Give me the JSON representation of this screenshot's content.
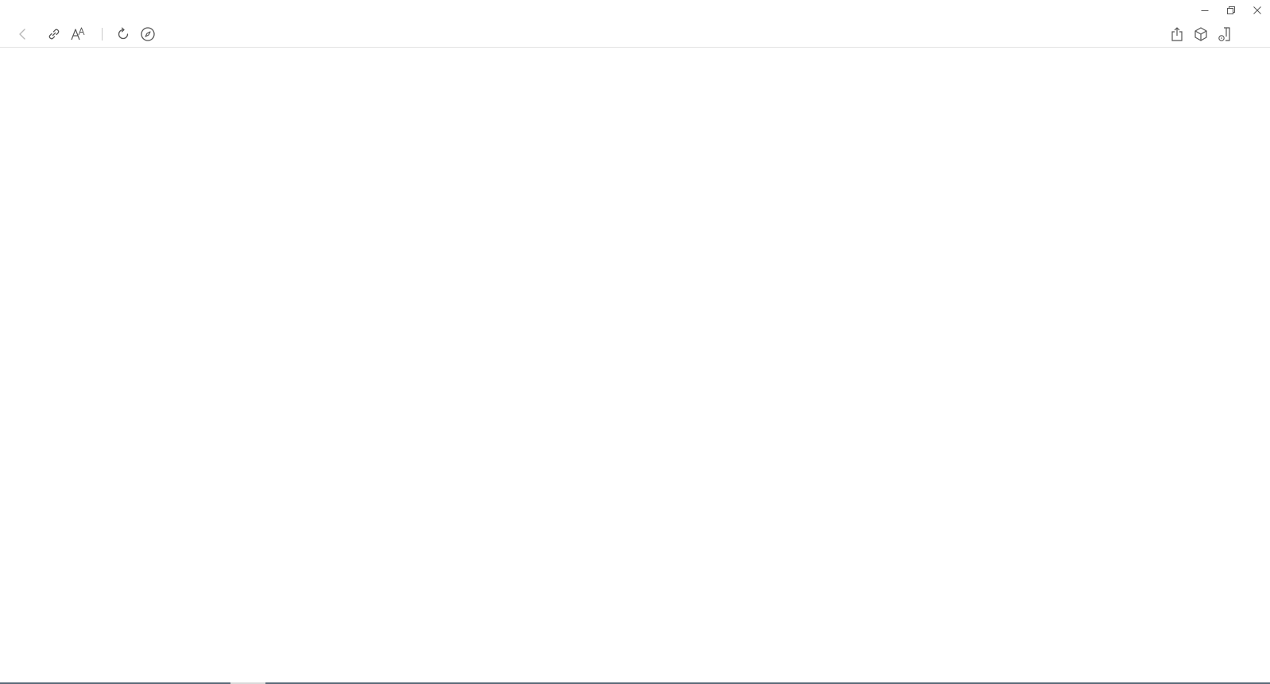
{
  "window": {
    "controls": [
      {
        "name": "minimize",
        "icon": "minimize-icon"
      },
      {
        "name": "restore",
        "icon": "restore-icon"
      },
      {
        "name": "close",
        "icon": "close-icon"
      }
    ]
  },
  "toolbar": {
    "left": [
      {
        "name": "back",
        "icon": "chevron-left-icon",
        "enabled": false
      },
      {
        "name": "link",
        "icon": "link-icon",
        "enabled": true
      },
      {
        "name": "text-size",
        "icon": "text-size-icon",
        "enabled": true
      },
      {
        "name": "refresh",
        "icon": "refresh-icon",
        "enabled": true
      },
      {
        "name": "navigate",
        "icon": "compass-icon",
        "enabled": true
      }
    ],
    "right": [
      {
        "name": "share",
        "icon": "share-icon",
        "enabled": true
      },
      {
        "name": "package",
        "icon": "cube-icon",
        "enabled": true
      },
      {
        "name": "device-settings",
        "icon": "device-settings-icon",
        "enabled": true
      }
    ]
  },
  "colors": {
    "icon": "#555555",
    "icon_disabled": "#b8b8b8",
    "divider": "#e3e3e3",
    "background": "#ffffff"
  }
}
